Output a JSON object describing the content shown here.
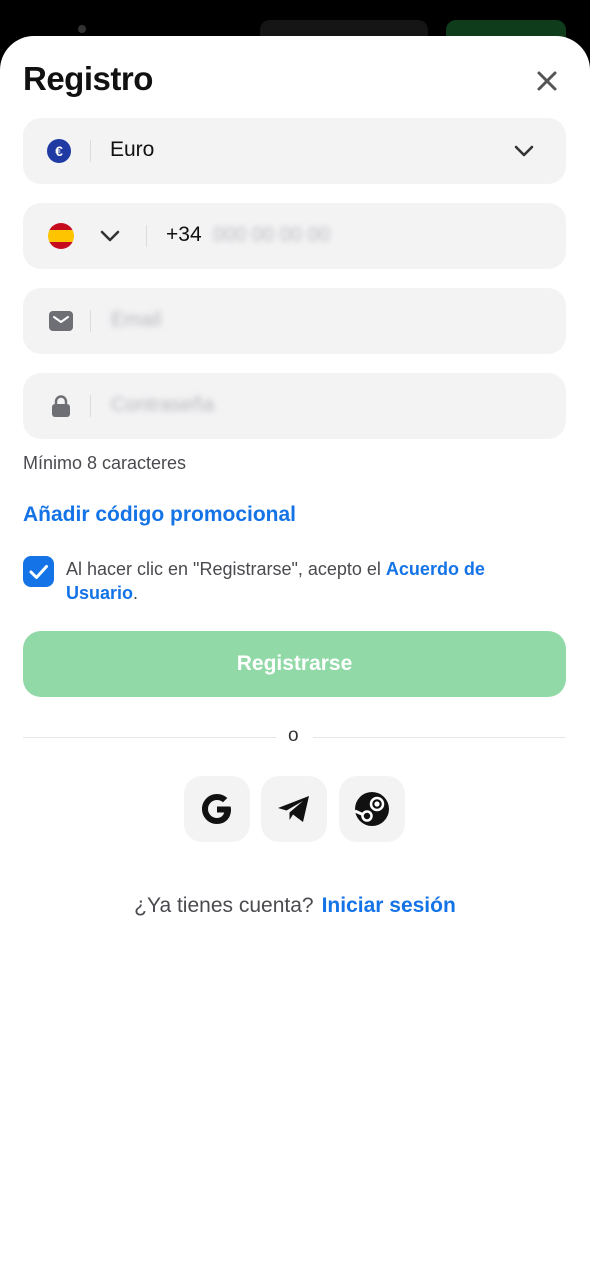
{
  "modal": {
    "title": "Registro"
  },
  "currency": {
    "label": "Euro",
    "symbol": "€"
  },
  "phone": {
    "prefix": "+34",
    "placeholder": "000 00 00 00"
  },
  "email": {
    "placeholder": "Email"
  },
  "password": {
    "placeholder": "Contraseña",
    "hint": "Mínimo 8 caracteres"
  },
  "promo": {
    "label": "Añadir código promocional"
  },
  "terms": {
    "checked": true,
    "text": "Al hacer clic en \"Registrarse\", acepto el ",
    "link": "Acuerdo de Usuario",
    "end": "."
  },
  "register": {
    "label": "Registrarse"
  },
  "separator": {
    "text": "o"
  },
  "social": {
    "icons": [
      "google-icon",
      "telegram-icon",
      "steam-icon"
    ]
  },
  "login": {
    "question": "¿Ya tienes cuenta?",
    "link": "Iniciar sesión"
  },
  "colors": {
    "accent": "#1473e6",
    "register_button": "#92d9a8",
    "field_bg": "#f3f3f4"
  }
}
